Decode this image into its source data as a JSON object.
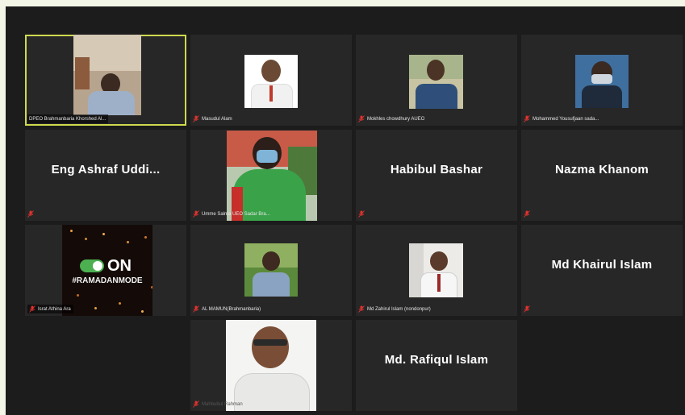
{
  "participants": [
    {
      "name": "DPEO Brahmanbaria Khorshed Al..."
    },
    {
      "name": "Masudul Alam"
    },
    {
      "name": "Mokhles chowdhury AUEO"
    },
    {
      "name": "Mohammed Yousufjaan sada..."
    },
    {
      "name": "Eng Ashraf Uddi..."
    },
    {
      "name": "Umme Salma UEO Sadar Bra..."
    },
    {
      "name": "Habibul Bashar"
    },
    {
      "name": "Nazma Khanom"
    },
    {
      "name": "Israt Athina Ara"
    },
    {
      "name": "AL MAMUN(Brahmanbaria)"
    },
    {
      "name": "Md Zahirul Islam (nondonpur)"
    },
    {
      "name": "Md Khairul Islam"
    },
    {
      "name": "Mahbubul Rahman"
    },
    {
      "name": "Md. Rafiqul Islam"
    }
  ],
  "banner": {
    "line1": "ON",
    "line2": "#RAMADANMODE"
  },
  "colors": {
    "active_border": "#cfd94e",
    "muted_icon": "#e0332e",
    "tile_bg": "#272727"
  }
}
